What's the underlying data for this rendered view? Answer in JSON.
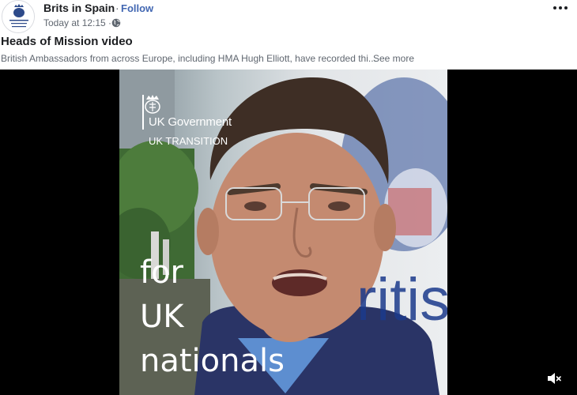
{
  "post": {
    "page_name": "Brits in Spain",
    "separator": "·",
    "follow_label": "Follow",
    "timestamp": "Today at 12:15 ·",
    "privacy_icon": "globe-icon",
    "options_icon": "more-options-icon",
    "avatar_text": "British Embassy Madrid",
    "title": "Heads of Mission video",
    "text": "British Ambassadors from across Europe, including HMA Hugh Elliott, have recorded thi...",
    "see_more_label": "See more"
  },
  "video": {
    "logo_title": "UK Government",
    "logo_subtitle": "UK TRANSITION",
    "caption_lines": [
      "for",
      "UK",
      "nationals"
    ],
    "background_sign_text": "ritis",
    "mute_icon": "speaker-muted-icon"
  },
  "colors": {
    "link_blue": "#4267b2",
    "text_primary": "#1c1e21",
    "text_secondary": "#606770",
    "video_bg": "#000000"
  }
}
